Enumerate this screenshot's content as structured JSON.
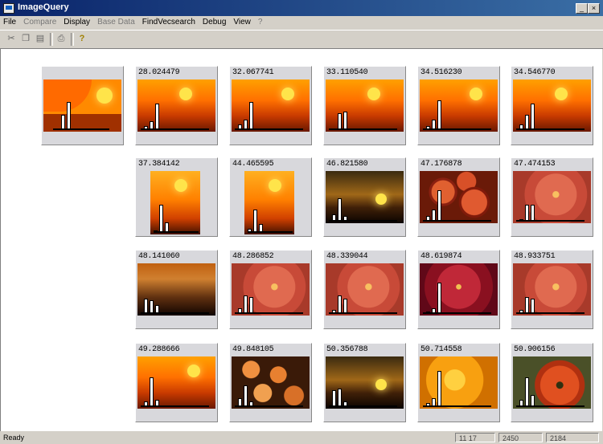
{
  "window": {
    "title": "ImageQuery",
    "buttons": {
      "minimize": "_",
      "maximize": "□",
      "close": "×"
    }
  },
  "menu": [
    "File",
    "Compare",
    "Display",
    "Base Data",
    "FindVecsearch",
    "Debug",
    "View",
    "?"
  ],
  "toolbar": {
    "buttons": [
      "cut",
      "copy",
      "paste",
      "print",
      "help"
    ],
    "glyphs": {
      "cut": "✂",
      "copy": "❐",
      "paste": "▤",
      "print": "⎙",
      "help": "?"
    }
  },
  "results": [
    {
      "score": "28.024479",
      "image": "sunset"
    },
    {
      "score": "32.067741",
      "image": "sunset"
    },
    {
      "score": "33.110540",
      "image": "sunset"
    },
    {
      "score": "34.516230",
      "image": "sunset"
    },
    {
      "score": "34.546770",
      "image": "sunset"
    },
    {
      "score": "37.384142",
      "image": "sunset-tall"
    },
    {
      "score": "44.465595",
      "image": "sunset-tall"
    },
    {
      "score": "46.821580",
      "image": "dark-sunset"
    },
    {
      "score": "47.176878",
      "image": "red-fruit"
    },
    {
      "score": "47.474153",
      "image": "flower"
    },
    {
      "score": "48.141060",
      "image": "dusk"
    },
    {
      "score": "48.286852",
      "image": "flower"
    },
    {
      "score": "48.339044",
      "image": "flower"
    },
    {
      "score": "48.619874",
      "image": "red-flower"
    },
    {
      "score": "48.933751",
      "image": "flower"
    },
    {
      "score": "49.288666",
      "image": "sunset"
    },
    {
      "score": "49.848105",
      "image": "peaches"
    },
    {
      "score": "50.356788",
      "image": "dark-sunset"
    },
    {
      "score": "50.714558",
      "image": "yellow-flower"
    },
    {
      "score": "50.906156",
      "image": "poppy"
    }
  ],
  "statusbar": {
    "text": "Ready",
    "cells": [
      "11 17",
      "2450",
      "2184"
    ]
  },
  "colors": {
    "titlebar_start": "#0a246a",
    "titlebar_end": "#3a6ea5",
    "window_bg": "#d4d0c8",
    "client_bg": "#ffffff"
  }
}
